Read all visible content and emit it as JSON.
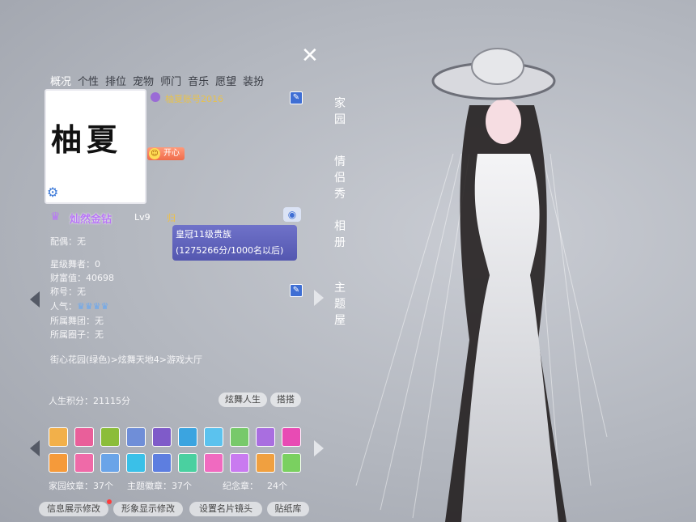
{
  "tabs": [
    "概况",
    "个性",
    "排位",
    "宠物",
    "师门",
    "音乐",
    "愿望",
    "装扮"
  ],
  "active_tab": "概况",
  "profile": {
    "avatar_text": "柚夏",
    "account_name": "柚夏账号2016",
    "mood": "开心",
    "vip_title": "灿然金钻",
    "level": "Lv9",
    "vip_badge": "归",
    "tooltip_line1": "皇冠11级贵族",
    "tooltip_line2": "(1275266分/1000名以后)"
  },
  "details": {
    "spouse": "配偶：无",
    "star_dancer": "星级舞者：0",
    "wealth": "财富值：40698",
    "title": "称号：无",
    "popularity_label": "人气：",
    "dance_group": "所属舞团：无",
    "circle": "所属圈子：无",
    "location": "街心花园(绿色)>炫舞天地4>游戏大厅",
    "life_score": "人生积分：21115分"
  },
  "buttons": {
    "dance_life": "炫舞人生",
    "outfit": "搭搭",
    "edit_info": "信息展示修改",
    "edit_image": "形象显示修改",
    "set_lens": "设置名片镜头",
    "sticker": "贴纸库"
  },
  "badge_counts": {
    "home": "家园纹章：37个",
    "theme": "主题徽章：37个",
    "memorial": "纪念章：",
    "memorial_count": "24个"
  },
  "side_links": [
    "家园",
    "情侣秀",
    "相册",
    "主题屋"
  ],
  "badge_colors": [
    "#f2b04a",
    "#e95f9a",
    "#8bbd3a",
    "#6f8ed8",
    "#7f5bc9",
    "#3ba4e0",
    "#5bc2ee",
    "#77c96a",
    "#a96ee0",
    "#e84bb4",
    "#f59a3a",
    "#ef6aa8",
    "#6aa4e8",
    "#3ac0e8",
    "#5d7ee0",
    "#4ad0a0",
    "#f06ac0",
    "#c97af0",
    "#f0a040",
    "#7ad060"
  ],
  "icons": [
    "close-icon",
    "gear-icon",
    "edit-icon",
    "camera-icon",
    "arrow-left-icon",
    "arrow-right-icon"
  ]
}
